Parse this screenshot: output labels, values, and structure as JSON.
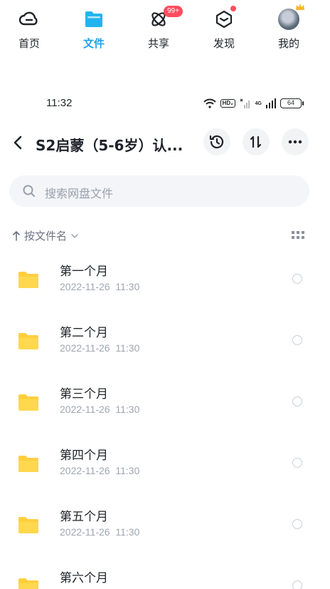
{
  "tabs": [
    {
      "label": "首页",
      "icon": "cloud-home-icon"
    },
    {
      "label": "文件",
      "icon": "folder-icon",
      "active": true
    },
    {
      "label": "共享",
      "icon": "share-atom-icon",
      "badge": "99+"
    },
    {
      "label": "发现",
      "icon": "discover-cube-icon",
      "dot": true
    },
    {
      "label": "我的",
      "icon": "avatar"
    }
  ],
  "status": {
    "time": "11:32",
    "hd": "HD₂",
    "net": "4G",
    "battery": "64"
  },
  "header": {
    "title": "S2启蒙（5-6岁）认..."
  },
  "search": {
    "placeholder": "搜索网盘文件"
  },
  "sort": {
    "label": "按文件名"
  },
  "files": [
    {
      "name": "第一个月",
      "date": "2022-11-26  11:30"
    },
    {
      "name": "第二个月",
      "date": "2022-11-26  11:30"
    },
    {
      "name": "第三个月",
      "date": "2022-11-26  11:30"
    },
    {
      "name": "第四个月",
      "date": "2022-11-26  11:30"
    },
    {
      "name": "第五个月",
      "date": "2022-11-26  11:30"
    },
    {
      "name": "第六个月",
      "date": ""
    }
  ],
  "colors": {
    "accent": "#1aa3e8",
    "badge": "#ff4d5e",
    "folder": "#ffcf3f"
  }
}
